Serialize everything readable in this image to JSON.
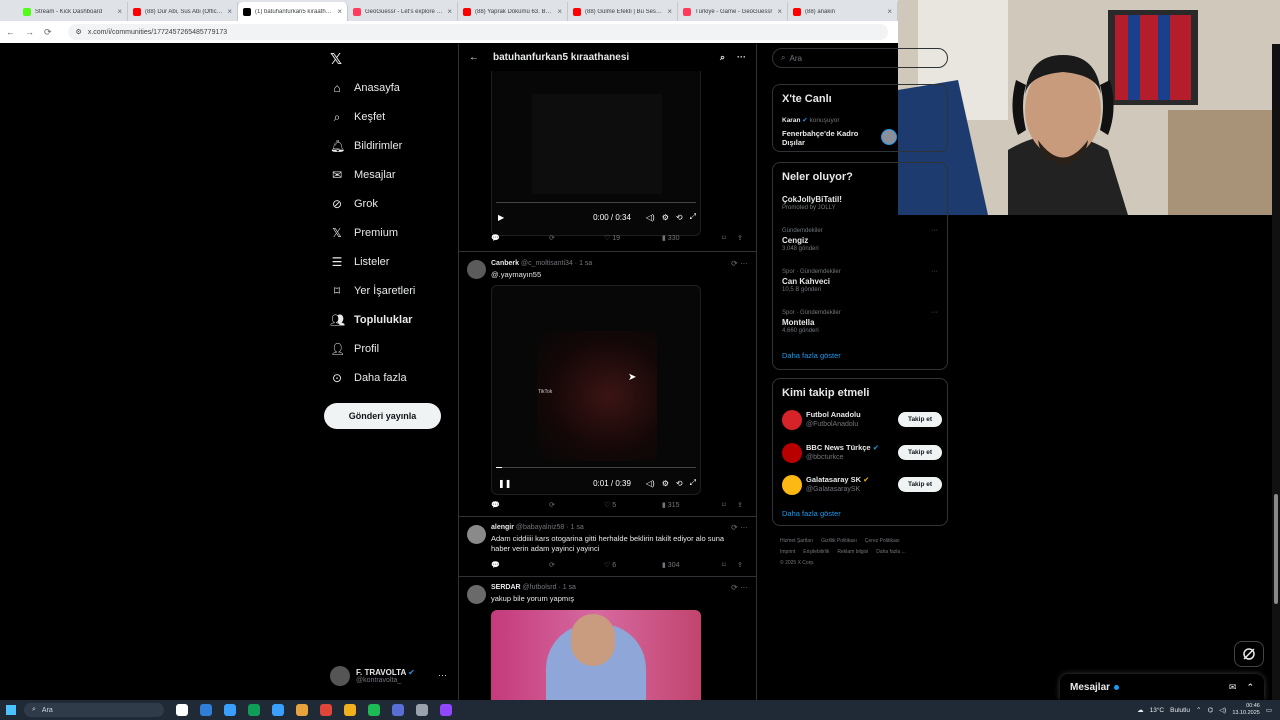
{
  "browser": {
    "tabs": [
      {
        "title": "Stream - Kick Dashboard",
        "color": "#53fc18",
        "active": false
      },
      {
        "title": "(88) Dur Abi, Sus Abi (Official V",
        "color": "#ff0000",
        "active": false
      },
      {
        "title": "(1) batuhanfurkan5 kıraathanesi",
        "color": "#000000",
        "active": true
      },
      {
        "title": "GeoGuessr - Let's explore the w",
        "color": "#ff3b5c",
        "active": false
      },
      {
        "title": "(88) Yaprak Dökümü 63. Bölüm",
        "color": "#ff0000",
        "active": false
      },
      {
        "title": "(88) Gülme Efekti | Bu Sese İnsa",
        "color": "#ff0000",
        "active": false
      },
      {
        "title": "Türkiye - Game - GeoGuessr",
        "color": "#ff3b5c",
        "active": false
      },
      {
        "title": "(88) anakin",
        "color": "#ff0000",
        "active": false
      }
    ],
    "url": "x.com/i/communities/1772457265485779173"
  },
  "nav": {
    "items": [
      {
        "label": "Anasayfa",
        "icon": "home-icon"
      },
      {
        "label": "Keşfet",
        "icon": "search-icon"
      },
      {
        "label": "Bildirimler",
        "icon": "bell-icon"
      },
      {
        "label": "Mesajlar",
        "icon": "mail-icon"
      },
      {
        "label": "Grok",
        "icon": "grok-icon"
      },
      {
        "label": "Premium",
        "icon": "x-logo-icon"
      },
      {
        "label": "Listeler",
        "icon": "list-icon"
      },
      {
        "label": "Yer İşaretleri",
        "icon": "bookmark-icon"
      },
      {
        "label": "Topluluklar",
        "icon": "communities-icon"
      },
      {
        "label": "Profil",
        "icon": "person-icon"
      },
      {
        "label": "Daha fazla",
        "icon": "more-circle-icon"
      }
    ],
    "post_button": "Gönderi yayınla",
    "profile": {
      "name": "F. TRAVOLTA",
      "handle": "@kontravolta_"
    }
  },
  "main": {
    "title": "batuhanfurkan5 kıraathanesi",
    "video1": {
      "time": "0:00 / 0:34",
      "progress": 0,
      "playing": false
    },
    "video1_actions": {
      "replies": "",
      "reposts": "",
      "likes": "19",
      "views": "330"
    },
    "tweets": [
      {
        "name": "Canberk",
        "handle": "@c_moltisanti34",
        "time": "1 sa",
        "text": "@.yaymayın55",
        "video": {
          "time": "0:01 / 0:39",
          "progress": 0.03,
          "playing": true,
          "watermark": "TikTok"
        },
        "actions": {
          "replies": "",
          "reposts": "",
          "likes": "5",
          "views": "315"
        }
      },
      {
        "name": "alengir",
        "handle": "@babayalniz58",
        "time": "1 sa",
        "text": "Adam ciddiiii kars otogarina gitti herhalde beklirin takilt ediyor alo suna haber verin adam yayinci yayinci",
        "actions": {
          "replies": "",
          "reposts": "",
          "likes": "6",
          "views": "304"
        }
      },
      {
        "name": "SERDAR",
        "handle": "@futbolsrd",
        "time": "1 sa",
        "text": "yakup bile yorum yapmış"
      }
    ]
  },
  "right": {
    "search_placeholder": "Ara",
    "live": {
      "title": "X'te Canlı",
      "host": "Karan",
      "status": "konuşuyor",
      "topic": "Fenerbahçe'de Kadro Dışılar"
    },
    "trends": {
      "title": "Neler oluyor?",
      "promoted": {
        "name": "ÇokJollyBiTatil!",
        "note": "Promoted by JOLLY"
      },
      "items": [
        {
          "category": "Gündemdekiler",
          "name": "Cengiz",
          "count": "3.048 gönderi"
        },
        {
          "category": "Spor · Gündemdekiler",
          "name": "Can Kahveci",
          "count": "10,5 B gönderi"
        },
        {
          "category": "Spor · Gündemdekiler",
          "name": "Montella",
          "count": "4.660 gönderi"
        }
      ],
      "more": "Daha fazla göster"
    },
    "follow": {
      "title": "Kimi takip etmeli",
      "items": [
        {
          "name": "Futbol Anadolu",
          "handle": "@FutbolAnadolu",
          "color": "#d6232a",
          "button": "Takip et"
        },
        {
          "name": "BBC News Türkçe",
          "handle": "@bbcturkce",
          "color": "#b80000",
          "button": "Takip et"
        },
        {
          "name": "Galatasaray SK",
          "handle": "@GalatasaraySK",
          "color": "#fdb913",
          "button": "Takip et"
        }
      ],
      "more": "Daha fazla göster"
    },
    "footer": [
      "Hizmet Şartları",
      "Gizlilik Politikası",
      "Çerez Politikası",
      "Imprint",
      "Erişilebilirlik",
      "Reklam bilgisi",
      "Daha fazla ...",
      "© 2025 X Corp."
    ]
  },
  "messages": {
    "title": "Mesajlar"
  },
  "taskbar": {
    "search": "Ara",
    "weather": "13°C",
    "weather_text": "Bulutlu",
    "time": "00:46",
    "date": "13.10.2025"
  }
}
